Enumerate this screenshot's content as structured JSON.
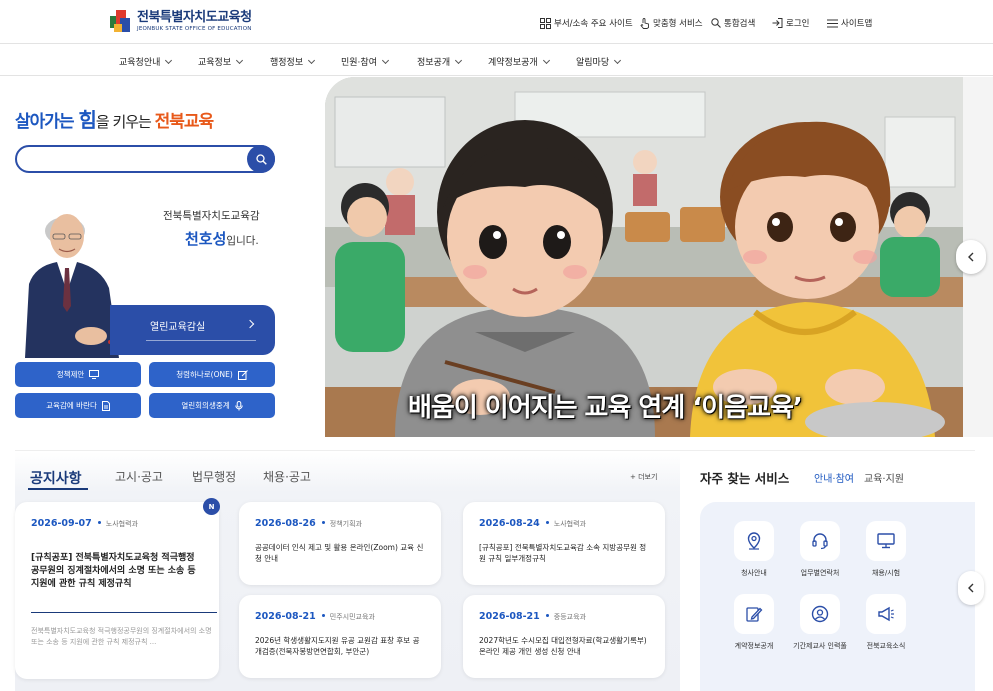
{
  "header": {
    "logo_title": "전북특별자치도교육청",
    "logo_sub": "JEONBUK STATE OFFICE OF EDUCATION",
    "util_links": [
      {
        "label": "부서/소속 주요 사이트",
        "icon": "grid-icon"
      },
      {
        "label": "맞춤형 서비스",
        "icon": "hand-pointer-icon"
      },
      {
        "label": "통합검색",
        "icon": "search-icon"
      },
      {
        "label": "로그인",
        "icon": "login-icon"
      },
      {
        "label": "사이트맵",
        "icon": "menu-icon"
      }
    ]
  },
  "nav": {
    "items": [
      "교육청안내",
      "교육정보",
      "행정정보",
      "민원·참여",
      "정보공개",
      "계약정보공개",
      "알림마당"
    ]
  },
  "left": {
    "slogan": {
      "part1": "살아가는 ",
      "part2": "힘",
      "part3": "을 키우는 ",
      "part4": "전북교육"
    },
    "search_placeholder": "",
    "superintendent_title": "전북특별자치도교육감",
    "superintendent_name": "천호성",
    "superintendent_suffix": "입니다.",
    "open_office_label": "열린교육감실",
    "quick_buttons": [
      {
        "label": "정책제안",
        "icon": "monitor-icon"
      },
      {
        "label": "청렴하나로(ONE)",
        "icon": "edit-icon"
      },
      {
        "label": "교육감에 바란다",
        "icon": "document-icon"
      },
      {
        "label": "열린회의생중계",
        "icon": "mic-icon"
      }
    ]
  },
  "hero": {
    "caption": "배움이 이어지는 교육 연계 ‘이음교육’"
  },
  "notices": {
    "tabs": [
      "공지사항",
      "고시·공고",
      "법무행정",
      "채용·공고"
    ],
    "more_label": "+ 더보기",
    "badge": "N",
    "featured": {
      "date": "2026-09-07",
      "dept": "노사협력과",
      "title": "[규칙공포] 전북특별자치도교육청 적극행정 공무원의 징계절차에서의 소명 또는 소송 등 지원에 관한 규칙 제정규칙",
      "excerpt": "전북특별자치도교육청 적극행정공무원의 징계절차에서의 소명 또는 소송 등 지원에 관한 규칙 제정규칙 ..."
    },
    "items": [
      {
        "date": "2026-08-26",
        "dept": "정책기획과",
        "title": "공공데이터 인식 제고 및 활용 온라인(Zoom) 교육 신청 안내"
      },
      {
        "date": "2026-08-24",
        "dept": "노사협력과",
        "title": "[규칙공포] 전북특별자치도교육감 소속 지방공무원 정원 규칙 일부개정규칙"
      },
      {
        "date": "2026-08-21",
        "dept": "민주시민교육과",
        "title": "2026년 학생생활지도지원 유공 교원감 표창 후보 공개검증(전북자봉방면연합회, 부안군)"
      },
      {
        "date": "2026-08-21",
        "dept": "중등교육과",
        "title": "2027학년도 수시모집 대입전형자료(학교생활기록부) 온라인 제공 개인 생성 신청 안내"
      }
    ]
  },
  "services": {
    "title": "자주 찾는 서비스",
    "tabs": [
      "안내·참여",
      "교육·지원"
    ],
    "items": [
      {
        "label": "청사안내",
        "icon": "map-pin-icon"
      },
      {
        "label": "업무별연락처",
        "icon": "headset-icon"
      },
      {
        "label": "채용/시험",
        "icon": "computer-icon"
      },
      {
        "label": "계약정보공개",
        "icon": "pen-icon"
      },
      {
        "label": "기간제교사 인력풀",
        "icon": "user-circle-icon"
      },
      {
        "label": "전북교육소식",
        "icon": "megaphone-icon"
      }
    ]
  }
}
